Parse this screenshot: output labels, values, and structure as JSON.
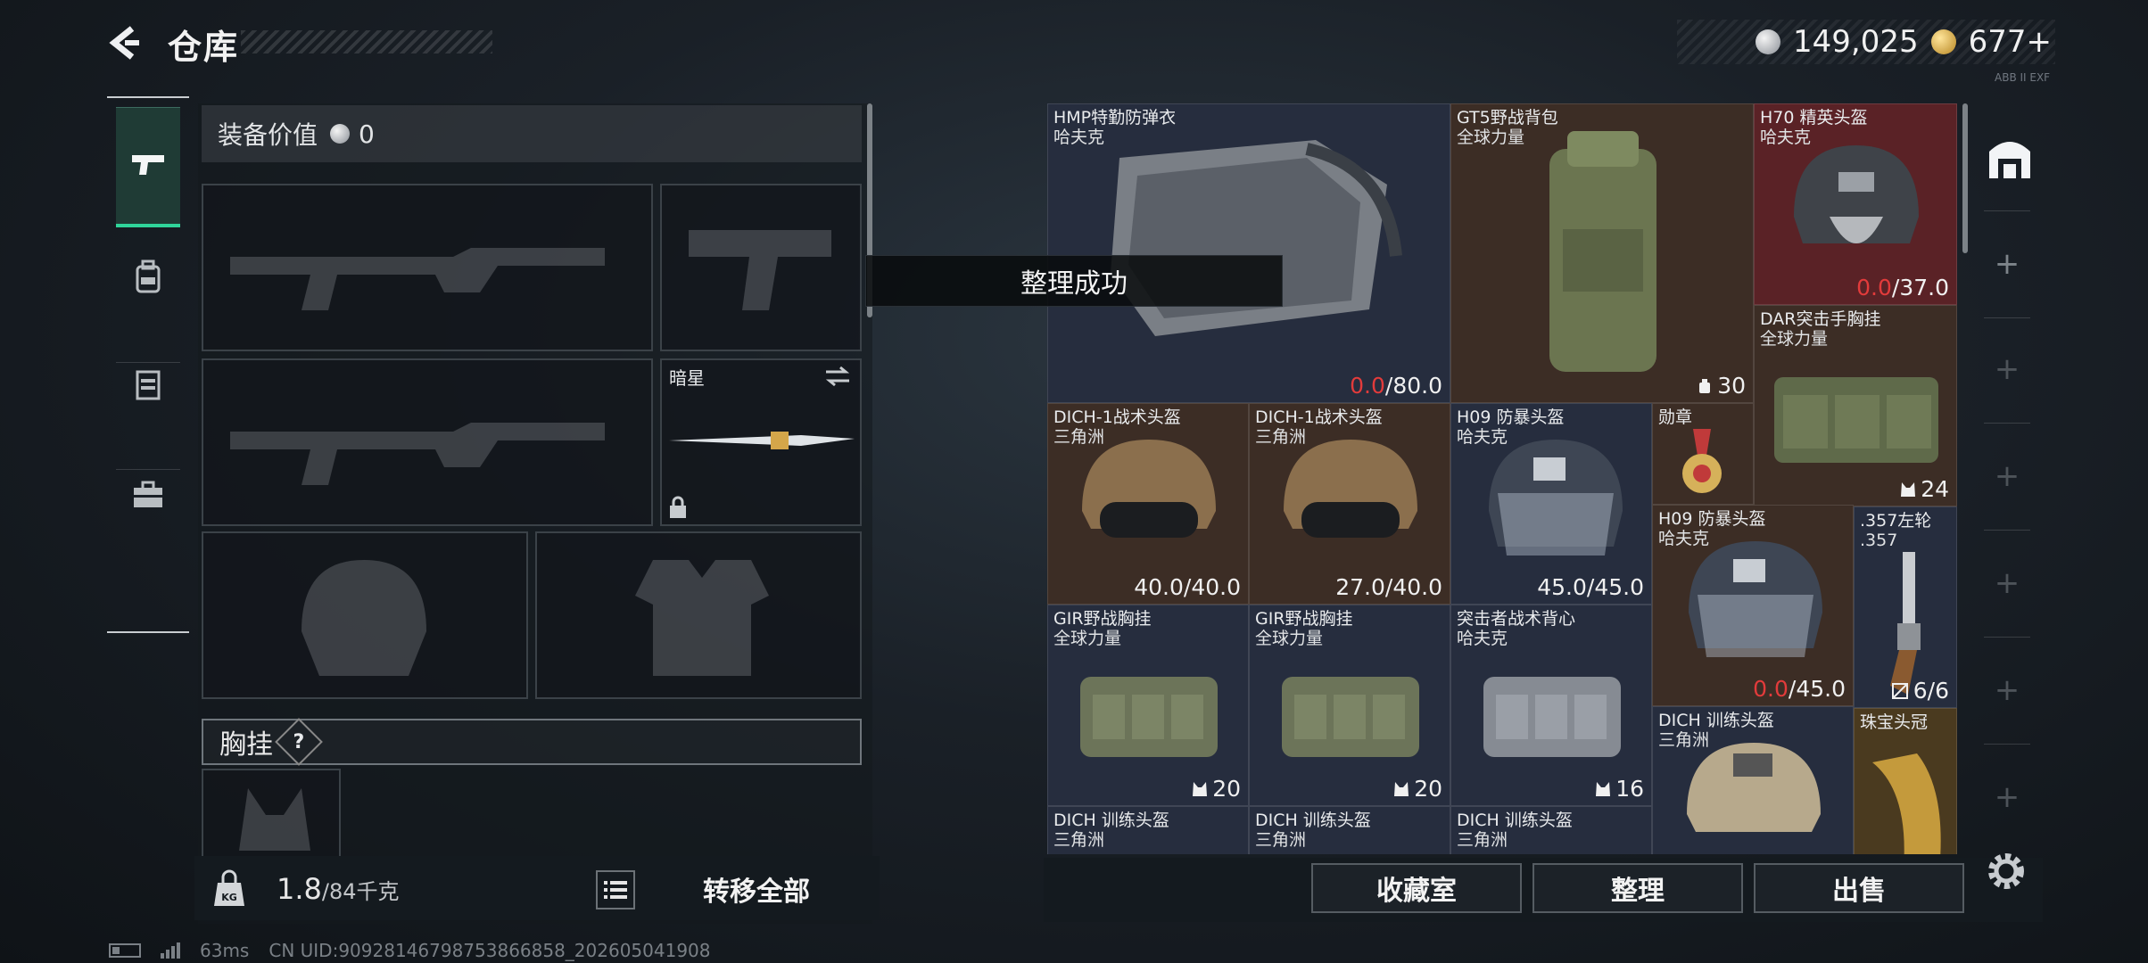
{
  "header": {
    "title": "仓库",
    "silver_amount": "149,025",
    "gold_amount": "677+",
    "corner_tag": "ABB II EXF"
  },
  "tabs": [
    {
      "name": "firearms",
      "active": true
    },
    {
      "name": "backpack",
      "active": false
    },
    {
      "name": "vest",
      "active": false
    },
    {
      "name": "toolbox",
      "active": false
    }
  ],
  "equipment": {
    "value_label": "装备价值",
    "value": "0",
    "melee_name": "暗星",
    "vest_label": "胸挂",
    "vest_help": "?"
  },
  "weight": {
    "current": "1.8",
    "capacity": "/84千克",
    "bag_badge": "KG"
  },
  "buttons": {
    "transfer_all": "转移全部",
    "collection": "收藏室",
    "sort": "整理",
    "sell": "出售"
  },
  "toast": "整理成功",
  "inventory": [
    {
      "name": "HMP特勤防弹衣",
      "sub": "哈夫克",
      "dur_cur": "0.0",
      "dur_max": "/80.0",
      "bg": "blue"
    },
    {
      "name": "GT5野战背包",
      "sub": "全球力量",
      "count": "30",
      "bg": "brown"
    },
    {
      "name": "H70 精英头盔",
      "sub": "哈夫克",
      "dur_cur": "0.0",
      "dur_max": "/37.0",
      "bg": "red"
    },
    {
      "name": "DAR突击手胸挂",
      "sub": "全球力量",
      "count": "24",
      "bg": "brown"
    },
    {
      "name": "DICH-1战术头盔",
      "sub": "三角洲",
      "dur": "40.0/40.0",
      "bg": "brown"
    },
    {
      "name": "DICH-1战术头盔",
      "sub": "三角洲",
      "dur": "27.0/40.0",
      "bg": "brown"
    },
    {
      "name": "H09 防暴头盔",
      "sub": "哈夫克",
      "dur": "45.0/45.0",
      "bg": "blue"
    },
    {
      "name": "勋章",
      "sub": "",
      "bg": "brown"
    },
    {
      "name": "H09 防暴头盔",
      "sub": "哈夫克",
      "dur_cur": "0.0",
      "dur_max": "/45.0",
      "bg": "brown"
    },
    {
      "name": ".357左轮",
      "sub": ".357",
      "count": "6/6",
      "bg": "blue"
    },
    {
      "name": "GIR野战胸挂",
      "sub": "全球力量",
      "count": "20",
      "bg": "blue"
    },
    {
      "name": "GIR野战胸挂",
      "sub": "全球力量",
      "count": "20",
      "bg": "blue"
    },
    {
      "name": "突击者战术背心",
      "sub": "哈夫克",
      "count": "16",
      "bg": "blue"
    },
    {
      "name": "DICH 训练头盔",
      "sub": "三角洲",
      "bg": "blue"
    },
    {
      "name": "珠宝头冠",
      "sub": "",
      "bg": "gold"
    },
    {
      "name": "DICH 训练头盔",
      "sub": "三角洲",
      "bg": "blue"
    },
    {
      "name": "DICH 训练头盔",
      "sub": "三角洲",
      "bg": "blue"
    },
    {
      "name": "DICH 训练头盔",
      "sub": "三角洲",
      "bg": "blue"
    }
  ],
  "status": {
    "ping": "63ms",
    "uid": "CN UID:9092814679875386​6858_202605041908"
  },
  "colors": {
    "accent_green": "#2fd59a",
    "durability_red": "#e23b3b",
    "item_blue": "#262d3e",
    "item_brown": "#3c2d25",
    "item_red": "#5a2226"
  }
}
